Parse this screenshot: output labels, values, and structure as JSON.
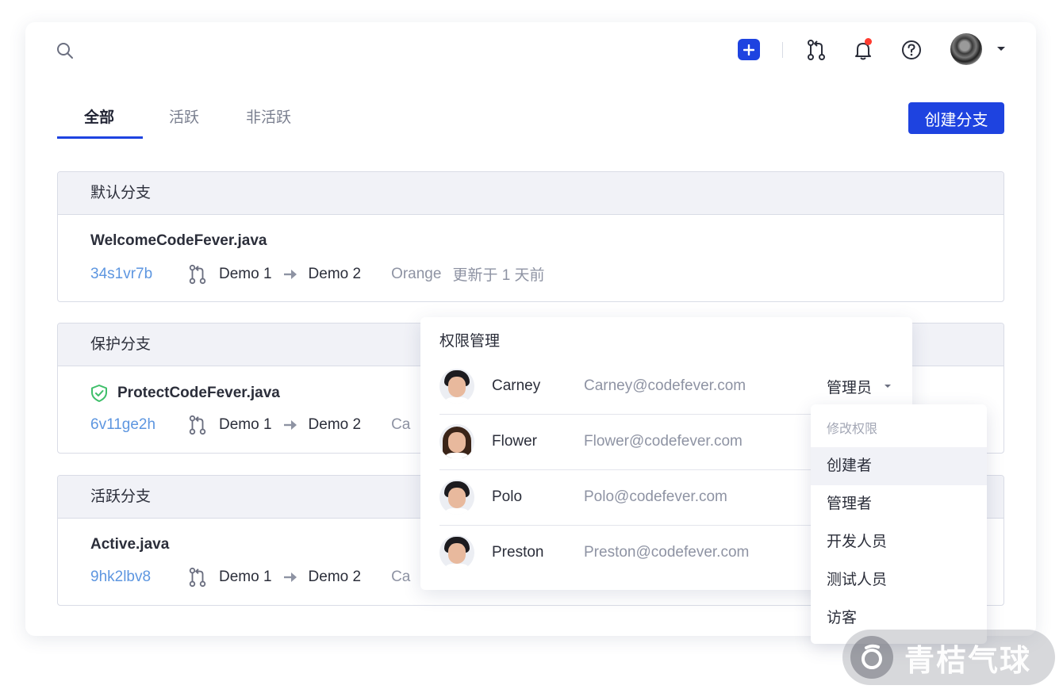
{
  "header": {
    "icons": [
      "search-icon",
      "plus-icon",
      "merge-request-icon",
      "bell-icon",
      "help-icon",
      "user-avatar",
      "caret-down-icon"
    ]
  },
  "tabs": [
    {
      "label": "全部",
      "active": true
    },
    {
      "label": "活跃",
      "active": false
    },
    {
      "label": "非活跃",
      "active": false
    }
  ],
  "create_button": "创建分支",
  "sections": [
    {
      "title": "默认分支",
      "file": "WelcomeCodeFever.java",
      "commit": "34s1vr7b",
      "from": "Demo 1",
      "to": "Demo 2",
      "author": "Orange",
      "updated": "更新于 1 天前"
    },
    {
      "title": "保护分支",
      "file": "ProtectCodeFever.java",
      "commit": "6v11ge2h",
      "from": "Demo 1",
      "to": "Demo 2",
      "author": "Ca",
      "protected": true
    },
    {
      "title": "活跃分支",
      "file": "Active.java",
      "commit": "9hk2lbv8",
      "from": "Demo 1",
      "to": "Demo 2",
      "author": "Ca"
    }
  ],
  "permission": {
    "title": "权限管理",
    "members": [
      {
        "name": "Carney",
        "email": "Carney@codefever.com",
        "role": "管理员"
      },
      {
        "name": "Flower",
        "email": "Flower@codefever.com"
      },
      {
        "name": "Polo",
        "email": "Polo@codefever.com"
      },
      {
        "name": "Preston",
        "email": "Preston@codefever.com"
      }
    ]
  },
  "role_menu": {
    "title": "修改权限",
    "items": [
      "创建者",
      "管理者",
      "开发人员",
      "测试人员",
      "访客"
    ]
  },
  "watermark": "青桔气球",
  "colors": {
    "accent": "#1e43e0",
    "commit": "#5d96e0",
    "notify": "#ff3b30",
    "success": "#3fbf6a"
  }
}
